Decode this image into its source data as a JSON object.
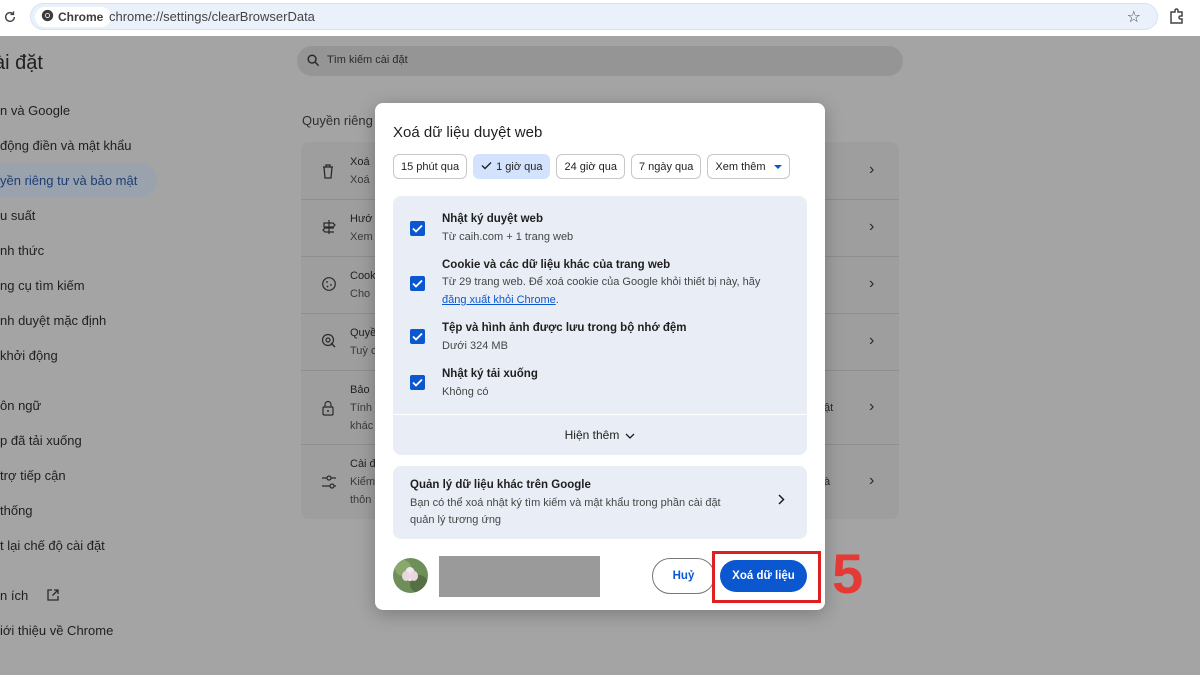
{
  "browser": {
    "chip_label": "Chrome",
    "url": "chrome://settings/clearBrowserData"
  },
  "settings": {
    "title": "ài đặt",
    "search_placeholder": "Tìm kiếm cài đặt",
    "sidebar": [
      "n và Google",
      "động điền và mật khẩu",
      "yền riêng tư và bảo mật",
      "u suất",
      "nh thức",
      "ng cụ tìm kiếm",
      "nh duyệt mặc định",
      "khởi động",
      "ôn ngữ",
      "p đã tải xuống",
      "trợ tiếp cận",
      "thống",
      "t lại chế độ cài đặt",
      "n ích",
      "iới thiệu về Chrome"
    ],
    "section_title": "Quyền riêng",
    "rows": [
      {
        "l1": "Xoá",
        "l2": "Xoá"
      },
      {
        "l1": "Hướ",
        "l2": "Xem"
      },
      {
        "l1": "Cook",
        "l2": "Cho"
      },
      {
        "l1": "Quyề",
        "l2": "Tuỳ c"
      },
      {
        "l1": "Bảo",
        "l2": "Tính",
        "l3": "khác",
        "tail": "ật"
      },
      {
        "l1": "Cài đ",
        "l2": "Kiểm",
        "l3": "thôn",
        "tail": "à"
      }
    ]
  },
  "dialog": {
    "title": "Xoá dữ liệu duyệt web",
    "time_ranges": [
      "15 phút qua",
      "1 giờ qua",
      "24 giờ qua",
      "7 ngày qua",
      "Xem thêm"
    ],
    "selected_range": "1 giờ qua",
    "items": [
      {
        "title": "Nhật ký duyệt web",
        "sub": "Từ caih.com + 1 trang web"
      },
      {
        "title": "Cookie và các dữ liệu khác của trang web",
        "sub": "Từ 29 trang web. Để xoá cookie của Google khỏi thiết bị này, hãy",
        "link": "đăng xuất khỏi Chrome",
        "link_suffix": "."
      },
      {
        "title": "Tệp và hình ảnh được lưu trong bộ nhớ đệm",
        "sub": "Dưới 324 MB"
      },
      {
        "title": "Nhật ký tải xuống",
        "sub": "Không có"
      }
    ],
    "show_more": "Hiện thêm",
    "google_box": {
      "title": "Quản lý dữ liệu khác trên Google",
      "sub1": "Bạn có thể xoá nhật ký tìm kiếm và mật khẩu trong phần cài đặt",
      "sub2": "quản lý tương ứng"
    },
    "cancel_label": "Huỷ",
    "delete_label": "Xoá dữ liệu"
  },
  "annotation": {
    "step_number": "5",
    "color": "#e53935"
  },
  "colors": {
    "accent": "#0b57d0",
    "checkbox": "#0b57d0",
    "item_bg": "#e9eef6"
  }
}
